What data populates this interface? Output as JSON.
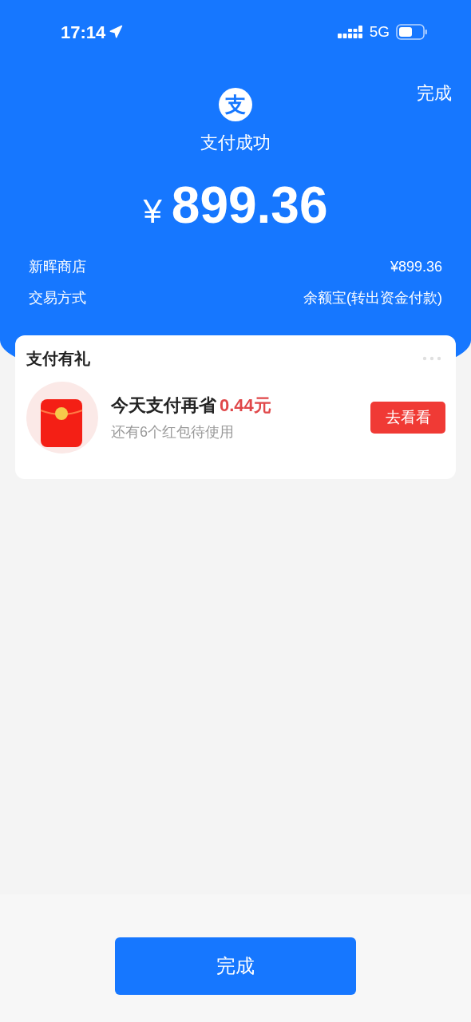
{
  "status_bar": {
    "time": "17:14",
    "network": "5G"
  },
  "header": {
    "done_link": "完成",
    "logo_text": "支",
    "title": "支付成功",
    "currency": "¥",
    "amount": "899.36"
  },
  "details": [
    {
      "label": "新晖商店",
      "value": "¥899.36"
    },
    {
      "label": "交易方式",
      "value": "余额宝(转出资金付款)"
    }
  ],
  "promo_card": {
    "title": "支付有礼",
    "headline": "今天支付再省",
    "highlight": "0.44元",
    "subtitle": "还有6个红包待使用",
    "button": "去看看"
  },
  "footer": {
    "button": "完成"
  }
}
